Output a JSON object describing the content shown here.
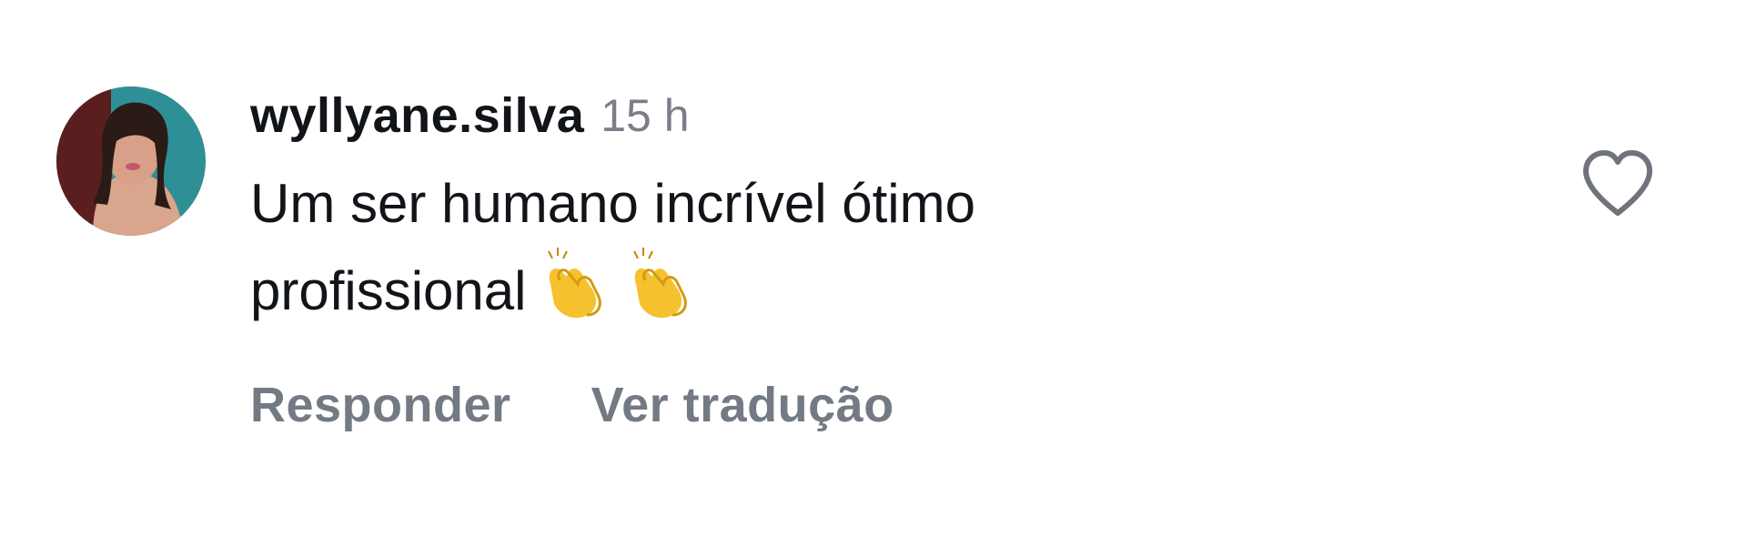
{
  "comment": {
    "username": "wyllyane.silva",
    "timestamp": "15 h",
    "text": "Um ser humano incrível ótimo profissional",
    "emojis": [
      "clapping-hands",
      "clapping-hands"
    ],
    "actions": {
      "reply_label": "Responder",
      "translate_label": "Ver tradução"
    },
    "like_icon": "heart-outline-icon",
    "avatar_icon": "avatar"
  },
  "colors": {
    "text": "#111418",
    "secondary": "#737a84",
    "background": "#ffffff"
  }
}
